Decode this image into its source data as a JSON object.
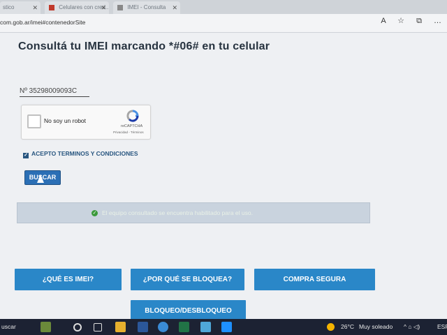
{
  "browser": {
    "tabs": [
      {
        "label": "stico"
      },
      {
        "label": "Celulares con cred..."
      },
      {
        "label": "IMEI - Consulta"
      }
    ],
    "url": "com.gob.ar/imei#contenedorSite",
    "icons": [
      "read-aloud-icon",
      "favorite-icon",
      "extensions-icon",
      "more-icon"
    ]
  },
  "main": {
    "title": "Consultá tu IMEI marcando *#06# en tu celular",
    "imei_value": "Nº 35298009093C",
    "recaptcha": {
      "label": "No soy un robot",
      "brand": "reCAPTCHA",
      "links": "Privacidad - Términos"
    },
    "accept_label": "ACEPTO TERMINOS Y CONDICIONES",
    "search_button": "BUSCAR",
    "status_message": "El equipo consultado se encuentra habilitado para el uso."
  },
  "actions": [
    {
      "label": "¿QUÉ ES IMEI?"
    },
    {
      "label": "¿POR QUÉ SE BLOQUEA?"
    },
    {
      "label": "COMPRA SEGURA"
    },
    {
      "label": "BLOQUEO/DESBLOQUEO"
    }
  ],
  "taskbar": {
    "search": "uscar",
    "temperature": "26°C",
    "weather": "Muy soleado",
    "language": "ESP"
  },
  "colors": {
    "action_blue": "#2a87c8",
    "search_blue": "#2b6fb5",
    "success_green": "#3b9a3b"
  }
}
